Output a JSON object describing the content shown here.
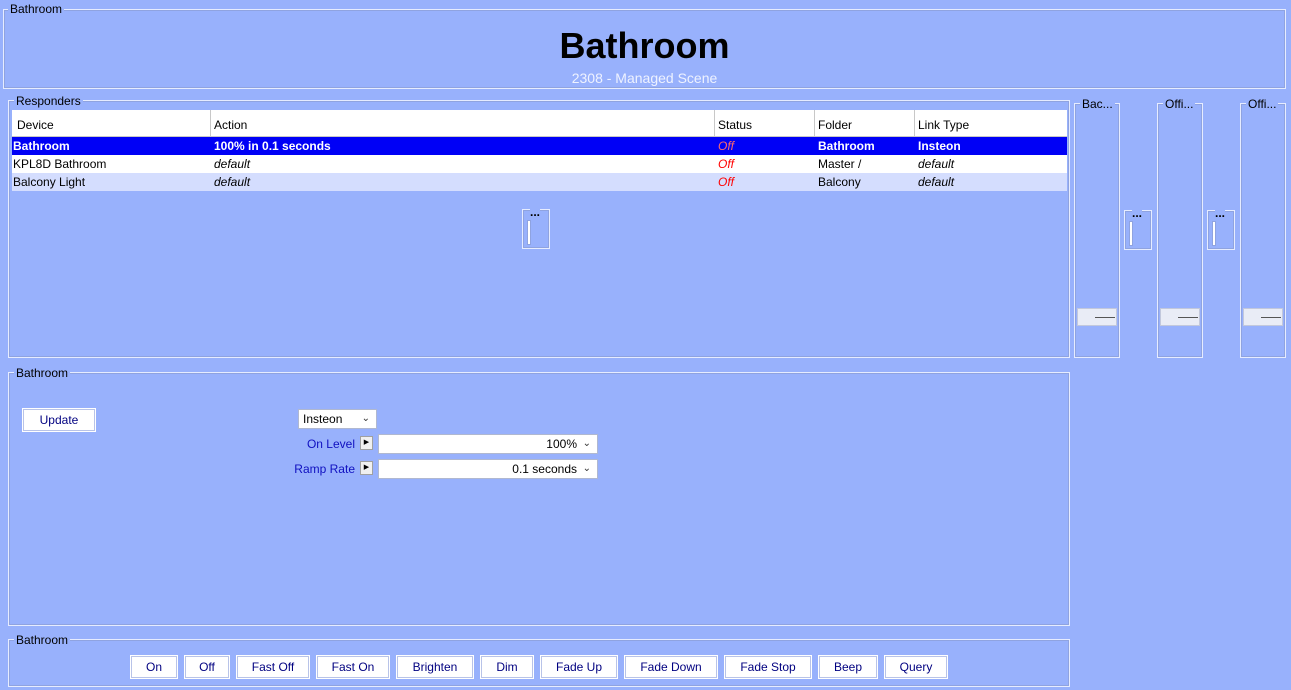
{
  "header": {
    "group_label": "Bathroom",
    "title": "Bathroom",
    "subtitle": "2308 - Managed Scene"
  },
  "responders": {
    "group_label": "Responders",
    "columns": [
      "Device",
      "Action",
      "Status",
      "Folder",
      "Link Type"
    ],
    "rows": [
      {
        "device": "Bathroom",
        "action": "100% in 0.1 seconds",
        "status": "Off",
        "folder": "Bathroom",
        "link_type": "Insteon"
      },
      {
        "device": "KPL8D Bathroom",
        "action": "default",
        "status": "Off",
        "folder": "Master /",
        "link_type": "default"
      },
      {
        "device": "Balcony Light",
        "action": "default",
        "status": "Off",
        "folder": "Balcony",
        "link_type": "default"
      }
    ],
    "mini_slider_label": "..."
  },
  "side_columns": [
    {
      "label": "Bac...",
      "mini_label": "..."
    },
    {
      "label": "Offi...",
      "mini_label": "..."
    },
    {
      "label": "Offi..."
    }
  ],
  "editor": {
    "group_label": "Bathroom",
    "update_label": "Update",
    "link_type_value": "Insteon",
    "on_level_label": "On Level",
    "on_level_value": "100%",
    "ramp_rate_label": "Ramp Rate",
    "ramp_rate_value": "0.1 seconds"
  },
  "commands": {
    "group_label": "Bathroom",
    "buttons": [
      "On",
      "Off",
      "Fast Off",
      "Fast On",
      "Brighten",
      "Dim",
      "Fade Up",
      "Fade Down",
      "Fade Stop",
      "Beep",
      "Query"
    ]
  }
}
